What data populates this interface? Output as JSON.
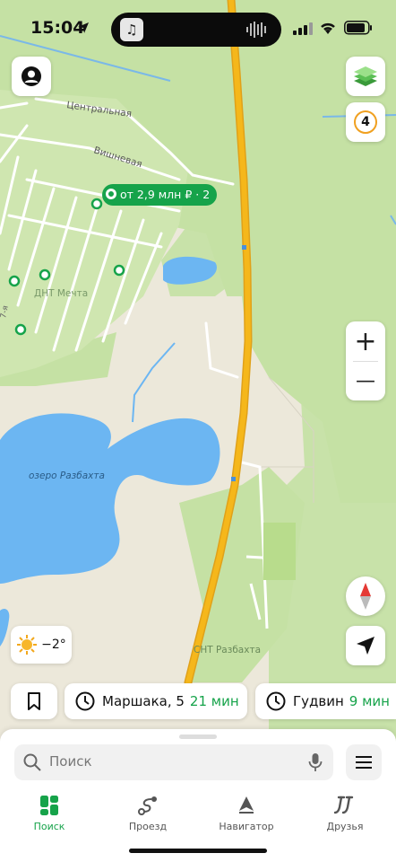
{
  "status_bar": {
    "time": "15:04"
  },
  "map": {
    "streets": [
      "Центральная",
      "Вишневая",
      "7-я"
    ],
    "places": [
      "ДНТ Мечта",
      "озеро Разбахта",
      "СНТ Разбахта"
    ],
    "price_marker": "от 2,9 млн ₽ · 2",
    "layers_badge": "4"
  },
  "controls": {
    "zoom_in": "+",
    "zoom_out": "—"
  },
  "weather": {
    "temp": "−2°"
  },
  "routes": [
    {
      "place": "Маршака, 5",
      "time": "21 мин"
    },
    {
      "place": "Гудвин",
      "time": "9 мин"
    }
  ],
  "search": {
    "placeholder": "Поиск"
  },
  "tabs": [
    {
      "label": "Поиск",
      "active": true
    },
    {
      "label": "Проезд",
      "active": false
    },
    {
      "label": "Навигатор",
      "active": false
    },
    {
      "label": "Друзья",
      "active": false
    }
  ],
  "colors": {
    "accent": "#16a34a",
    "road": "#f5b71b",
    "water": "#6cb6f2",
    "forest": "#c6e3a5"
  }
}
